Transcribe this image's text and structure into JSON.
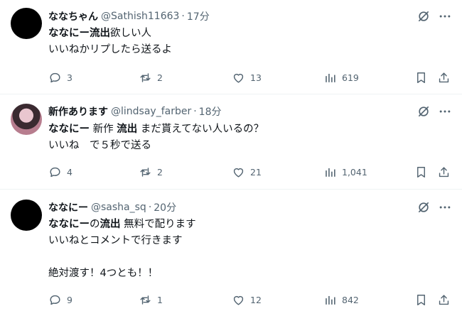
{
  "tweets": [
    {
      "name": "ななちゃん",
      "handle": "@Sathish11663",
      "sep": "·",
      "time": "17分",
      "avatar": "black",
      "lines": [
        [
          {
            "t": "ななにー流出",
            "b": true
          },
          {
            "t": "欲しい人",
            "b": false
          }
        ],
        [
          {
            "t": "いいねかリプしたら送るよ",
            "b": false
          }
        ]
      ],
      "replies": "3",
      "retweets": "2",
      "likes": "13",
      "views": "619"
    },
    {
      "name": "新作あります",
      "handle": "@lindsay_farber",
      "sep": "·",
      "time": "18分",
      "avatar": "photo",
      "lines": [
        [
          {
            "t": "ななにー",
            "b": true
          },
          {
            "t": " 新作 ",
            "b": false
          },
          {
            "t": "流出",
            "b": true
          },
          {
            "t": " まだ貰えてない人いるの？",
            "b": false
          }
        ],
        [
          {
            "t": "いいね　で５秒で送る",
            "b": false
          }
        ]
      ],
      "replies": "4",
      "retweets": "2",
      "likes": "21",
      "views": "1,041"
    },
    {
      "name": "ななにー",
      "handle": "@sasha_sq",
      "sep": "·",
      "time": "20分",
      "avatar": "black",
      "lines": [
        [
          {
            "t": "ななにー",
            "b": true
          },
          {
            "t": "の",
            "b": false
          },
          {
            "t": "流出",
            "b": true
          },
          {
            "t": " 無料で配ります",
            "b": false
          }
        ],
        [
          {
            "t": "いいねとコメントで行きます",
            "b": false
          }
        ],
        [],
        [
          {
            "t": "絶対渡す！4つとも！！",
            "b": false
          }
        ]
      ],
      "replies": "9",
      "retweets": "1",
      "likes": "12",
      "views": "842"
    }
  ],
  "icons": {
    "grok": "grok-icon",
    "more": "more-icon",
    "reply": "reply-icon",
    "retweet": "retweet-icon",
    "like": "like-icon",
    "views": "views-icon",
    "bookmark": "bookmark-icon",
    "share": "share-icon"
  },
  "colors": {
    "text": "#0f1419",
    "secondary": "#536471",
    "divider": "#eff3f4"
  }
}
